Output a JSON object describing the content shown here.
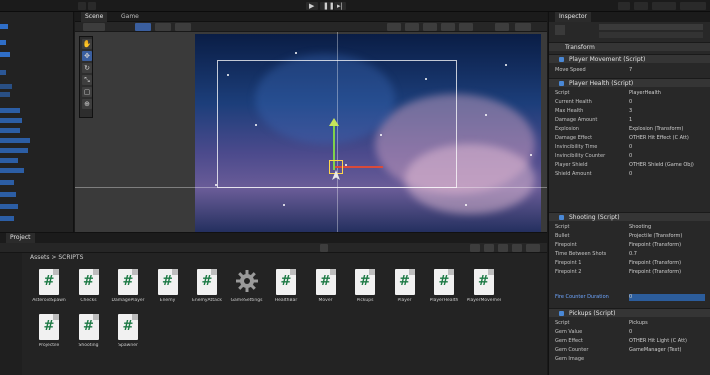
{
  "toolbar": {
    "right_labels": [
      "",
      "",
      ""
    ]
  },
  "scene_tabs": [
    {
      "label": "Scene"
    },
    {
      "label": "Game"
    }
  ],
  "inspector": {
    "title": "Inspector",
    "object_name": "",
    "components": [
      {
        "name": "Transform"
      },
      {
        "name": "Player Movement (Script)"
      },
      {
        "name": "Player Health (Script)"
      },
      {
        "name": "Shooting (Script)"
      },
      {
        "name": "Pickups (Script)"
      }
    ],
    "fields": [
      {
        "label": "Move Speed",
        "value": "7"
      },
      {
        "label": "Script",
        "value": "PlayerHealth"
      },
      {
        "label": "Current Health",
        "value": "0"
      },
      {
        "label": "Max Health",
        "value": "3"
      },
      {
        "label": "Damage Amount",
        "value": "1"
      },
      {
        "label": "Explosion",
        "value": "Explosion (Transform)"
      },
      {
        "label": "Damage Effect",
        "value": "OTHER Hit Effect (C Att)"
      },
      {
        "label": "Invincibility Time",
        "value": "0"
      },
      {
        "label": "Invincibility Counter",
        "value": "0"
      },
      {
        "label": "Player Shield",
        "value": "OTHER Shield (Game Obj)"
      },
      {
        "label": "Shield Amount",
        "value": "0"
      },
      {
        "label": "Script",
        "value": "Shooting"
      },
      {
        "label": "Bullet",
        "value": "Projectile (Transform)"
      },
      {
        "label": "Firepoint",
        "value": "Firepoint (Transform)"
      },
      {
        "label": "Time Between Shots",
        "value": "0.7"
      },
      {
        "label": "Firepoint 1",
        "value": "Firepoint (Transform)"
      },
      {
        "label": "Firepoint 2",
        "value": "Firepoint (Transform)"
      },
      {
        "label": "Fire Counter Duration",
        "value": "0"
      },
      {
        "label": "Script",
        "value": "Pickups"
      },
      {
        "label": "Gem Value",
        "value": "0"
      },
      {
        "label": "Gem Effect",
        "value": "OTHER Hit Light (C Att)"
      },
      {
        "label": "Gem Counter",
        "value": "GameManager (Text)"
      },
      {
        "label": "Gem Image",
        "value": ""
      }
    ]
  },
  "project": {
    "tab_label": "Project",
    "breadcrumb": "Assets > SCRIPTS",
    "assets": [
      {
        "name": "AsteroidSpawn",
        "kind": "script"
      },
      {
        "name": "Checks",
        "kind": "script"
      },
      {
        "name": "DamagePlayer",
        "kind": "script"
      },
      {
        "name": "Enemy",
        "kind": "script"
      },
      {
        "name": "EnemyAttack",
        "kind": "script"
      },
      {
        "name": "GameSettings",
        "kind": "gear"
      },
      {
        "name": "HealthBar",
        "kind": "script"
      },
      {
        "name": "Mover",
        "kind": "script"
      },
      {
        "name": "Pickups",
        "kind": "script"
      },
      {
        "name": "Player",
        "kind": "script"
      },
      {
        "name": "PlayerHealth",
        "kind": "script"
      },
      {
        "name": "PlayerMovement",
        "kind": "script"
      },
      {
        "name": "Projectile",
        "kind": "script"
      },
      {
        "name": "Shooting",
        "kind": "script"
      },
      {
        "name": "Spawner",
        "kind": "script"
      }
    ]
  },
  "colors": {
    "editor_bg": "#232323",
    "selection_blue": "#2f6ec7",
    "script_green": "#1d7a45"
  }
}
